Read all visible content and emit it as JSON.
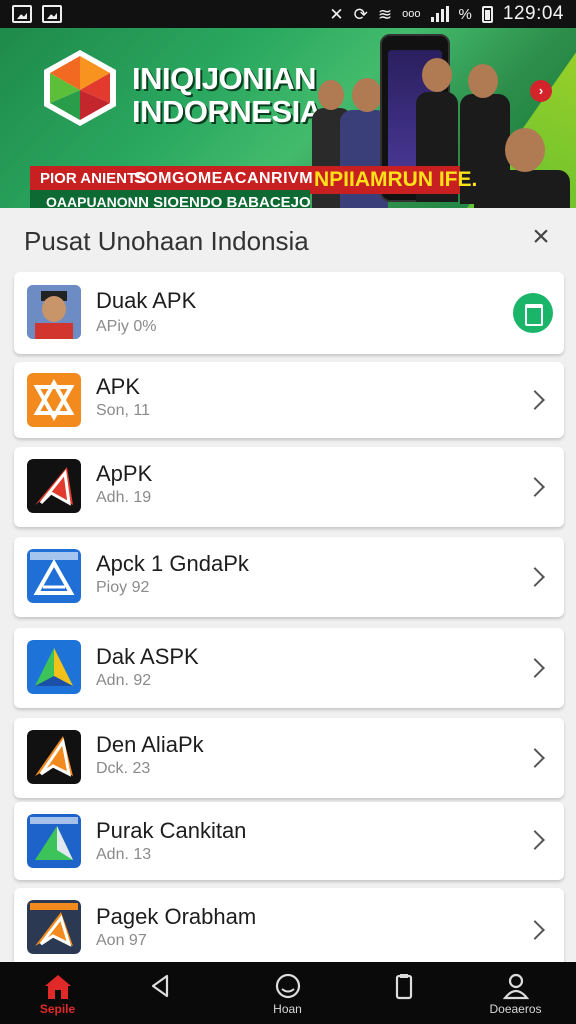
{
  "status_bar": {
    "time": "129:04",
    "percent": "%",
    "carrier": "ooo"
  },
  "banner": {
    "title_line1": "INIQIJONIAN",
    "title_line2": "INDORNESIA",
    "ribbon_left": "PIOR ANIENTS",
    "ribbon_middle": "SOMGOMEACANRIVM",
    "ribbon_right": "NPIIAMRUN IFE.",
    "sub_left": "OAAPUANON",
    "sub_middle": "IN SIOENDO BABACEJO"
  },
  "sheet": {
    "title": "Pusat Unohaan Indonsia",
    "close_glyph": "×"
  },
  "apps": [
    {
      "name": "Duak APK",
      "sub": "APiy 0%"
    },
    {
      "name": "APK",
      "sub": "Son, 11"
    },
    {
      "name": "ApPK",
      "sub": "Adh. 19"
    },
    {
      "name": "Apck 1 GndaPk",
      "sub": "Pioy 92"
    },
    {
      "name": "Dak ASPK",
      "sub": "Adn. 92"
    },
    {
      "name": "Den AliaPk",
      "sub": "Dck. 23"
    },
    {
      "name": "Purak Cankitan",
      "sub": "Adn. 13"
    },
    {
      "name": "Pagek Orabham",
      "sub": "Aon 97"
    }
  ],
  "bottom_nav": [
    {
      "label": "Sepile",
      "icon": "home-icon"
    },
    {
      "label": "",
      "icon": "back-icon"
    },
    {
      "label": "Hoan",
      "icon": "face-icon"
    },
    {
      "label": "",
      "icon": "clipboard-icon"
    },
    {
      "label": "Doeaeros",
      "icon": "person-icon"
    }
  ],
  "colors": {
    "accent_red": "#e02a2a",
    "install_green": "#1bb56a",
    "banner_green": "#2aa860"
  }
}
